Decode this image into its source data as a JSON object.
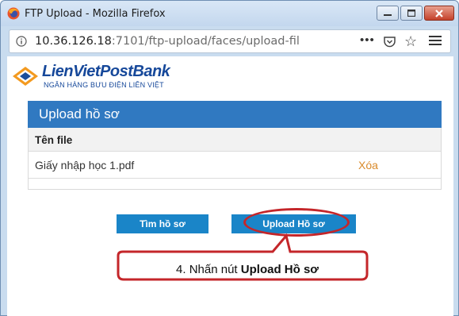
{
  "window": {
    "title": "FTP Upload - Mozilla Firefox"
  },
  "urlbar": {
    "host": "10.36.126.18",
    "path": ":7101/ftp-upload/faces/upload-fil",
    "more": "•••"
  },
  "brand": {
    "name": "LienVietPostBank",
    "tagline": "NGÂN HÀNG BƯU ĐIỆN LIÊN VIỆT"
  },
  "panel": {
    "title": "Upload hồ sơ",
    "column_header": "Tên file",
    "files": [
      {
        "name": "Giấy nhập học 1.pdf",
        "action": "Xóa"
      }
    ]
  },
  "buttons": {
    "find": "Tìm hồ sơ",
    "upload": "Upload Hồ sơ"
  },
  "annotation": {
    "prefix": "4. Nhấn nút ",
    "emphasis": "Upload Hồ sơ"
  },
  "colors": {
    "panel_header": "#3079c1",
    "button": "#1a85c8",
    "delete_link": "#d98a2b",
    "annotation": "#c4262a"
  }
}
